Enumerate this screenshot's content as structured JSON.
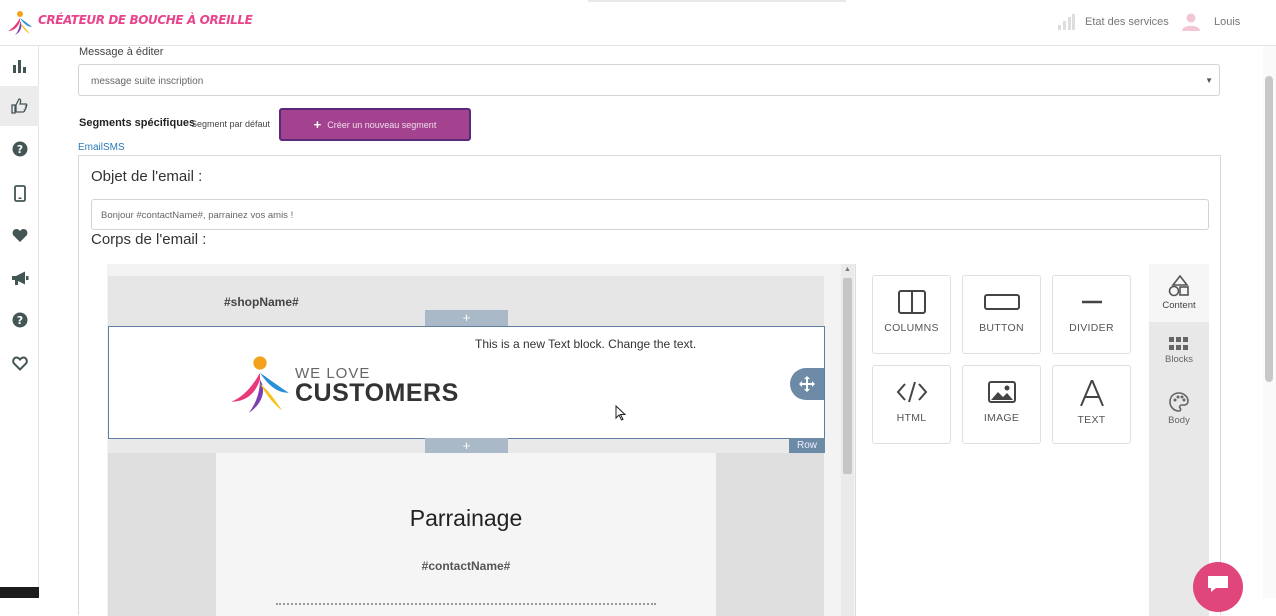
{
  "header": {
    "brand": "CRÉATEUR DE BOUCHE À OREILLE",
    "status_label": "Etat des services",
    "user_name": "Louis"
  },
  "sidebar": {
    "items": [
      "stats-icon",
      "thumbs-up-icon",
      "help-icon",
      "mobile-icon",
      "heart-icon",
      "megaphone-icon",
      "help-icon",
      "heart-outline-icon"
    ],
    "active_index": 1
  },
  "form": {
    "message_label": "Message à éditer",
    "message_value": "message suite inscription",
    "segments_label": "Segments spécifiques",
    "segment_default": "Segment par défaut",
    "create_segment_button": "Créer un nouveau segment",
    "channel_tabs": "EmailSMS",
    "subject_label": "Objet de l'email :",
    "subject_value": "Bonjour #contactName#, parrainez vos amis !",
    "body_label": "Corps de l'email :"
  },
  "email_canvas": {
    "shop_name": "#shopName#",
    "text_block": "This is a new Text block. Change the text.",
    "logo_line1": "WE LOVE",
    "logo_line2": "CUSTOMERS",
    "row_tag": "Row",
    "title": "Parrainage",
    "contact_name": "#contactName#",
    "add_symbol": "+"
  },
  "tools": [
    {
      "label": "COLUMNS",
      "icon": "columns-icon"
    },
    {
      "label": "BUTTON",
      "icon": "button-icon"
    },
    {
      "label": "DIVIDER",
      "icon": "divider-icon"
    },
    {
      "label": "HTML",
      "icon": "code-icon"
    },
    {
      "label": "IMAGE",
      "icon": "image-icon"
    },
    {
      "label": "TEXT",
      "icon": "text-icon"
    }
  ],
  "right_tabs": [
    {
      "label": "Content",
      "icon": "shapes-icon"
    },
    {
      "label": "Blocks",
      "icon": "blocks-icon"
    },
    {
      "label": "Body",
      "icon": "palette-icon"
    }
  ],
  "colors": {
    "brand_pink": "#e8448c",
    "segment_button": "#a3428f",
    "link_blue": "#2a7ab8",
    "row_blue": "#6d8aa6",
    "chat_pink": "#e0457c"
  }
}
